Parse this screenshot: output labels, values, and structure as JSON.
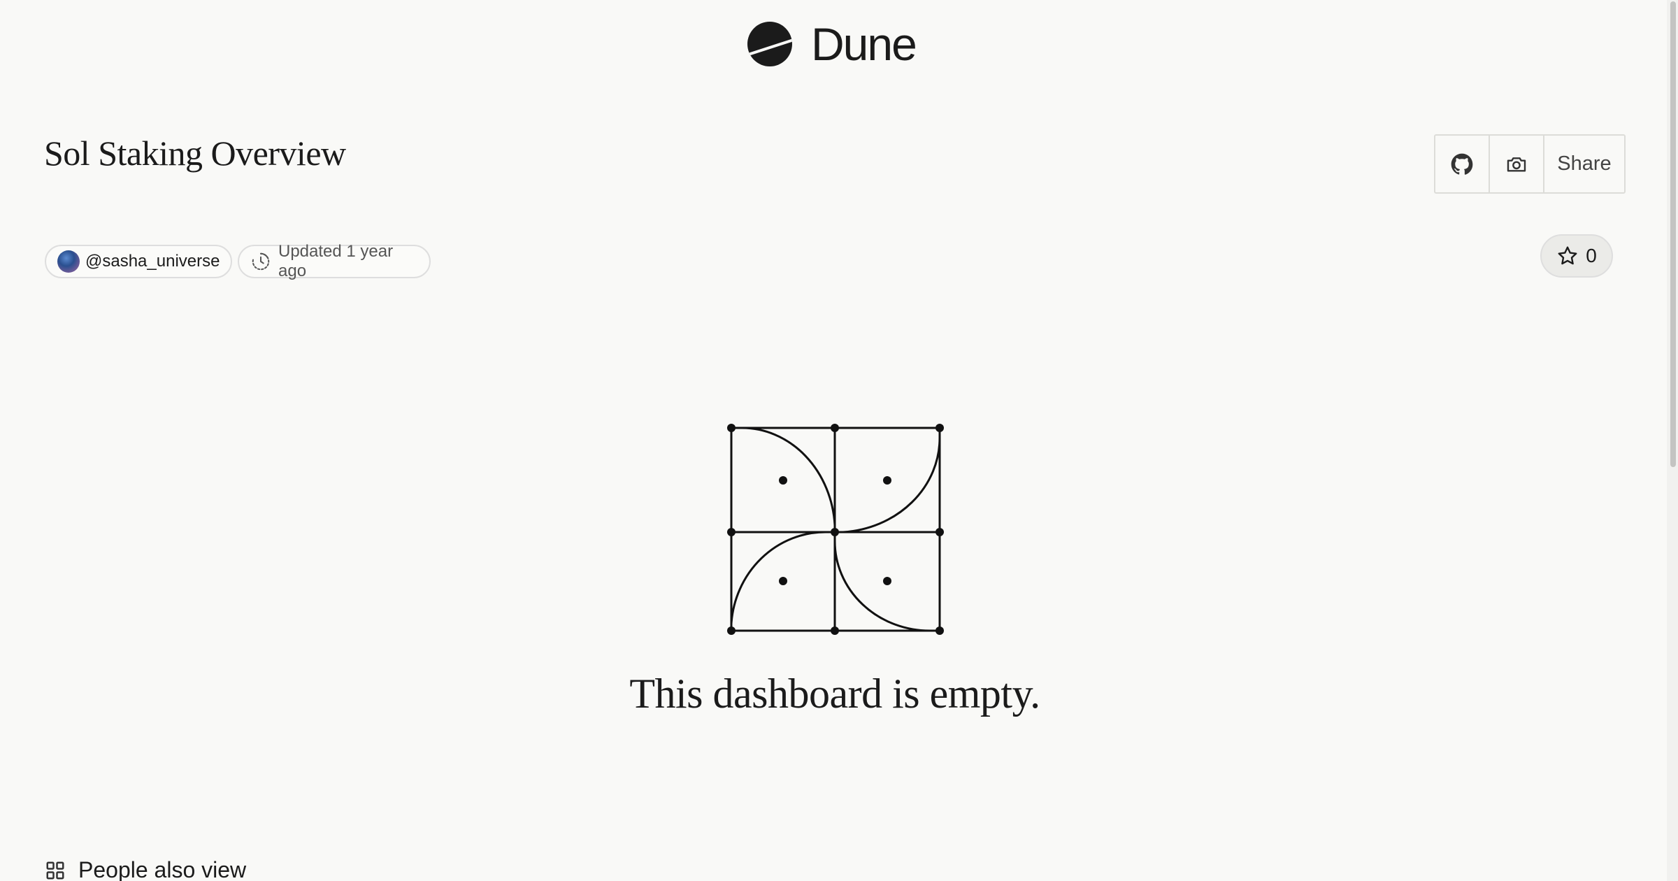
{
  "header": {
    "brand": "Dune",
    "logo_icon": "dune-logo-icon"
  },
  "dashboard": {
    "title": "Sol Staking Overview",
    "author": "@sasha_universe",
    "updated": "Updated 1 year ago",
    "star_count": "0"
  },
  "toolbar": {
    "github_icon": "github-icon",
    "camera_icon": "camera-icon",
    "share_label": "Share"
  },
  "empty_state": {
    "message": "This dashboard is empty."
  },
  "sections": {
    "people_also_view": "People also view"
  }
}
